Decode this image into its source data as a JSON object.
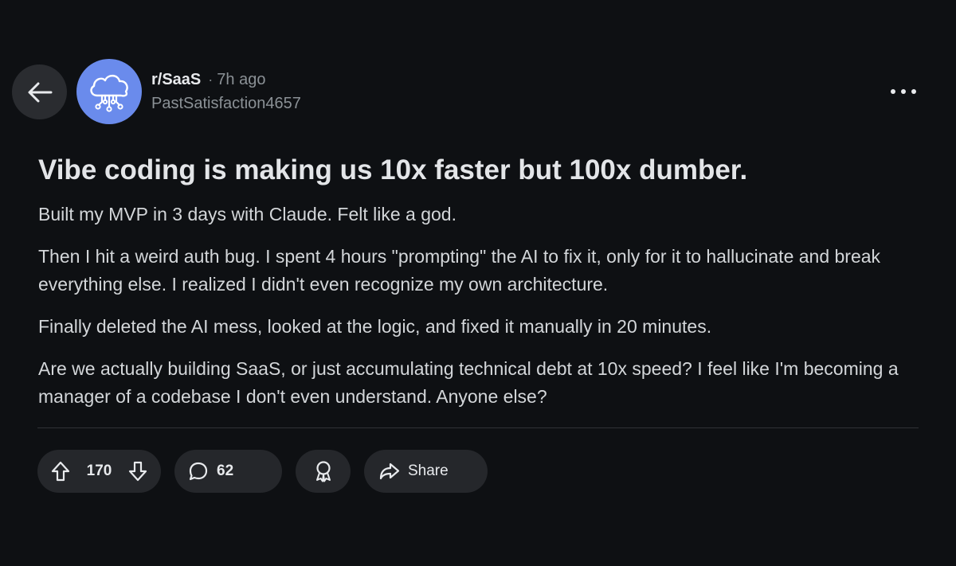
{
  "post": {
    "subreddit": "r/SaaS",
    "separator": "·",
    "time_ago": "7h ago",
    "author": "PastSatisfaction4657",
    "title": "Vibe coding is making us 10x faster but 100x dumber.",
    "paragraphs": [
      "Built my MVP in 3 days with Claude. Felt like a god.",
      "Then I hit a weird auth bug. I spent 4 hours \"prompting\" the AI to fix it, only for it to hallucinate and break everything else. I realized I didn't even recognize my own architecture.",
      "Finally deleted the AI mess, looked at the logic, and fixed it manually in 20 minutes.",
      "Are we actually building SaaS, or just accumulating technical debt at 10x speed? I feel like I'm becoming a manager of a codebase I don't even understand. Anyone else?"
    ]
  },
  "actions": {
    "upvote_count": "170",
    "comment_count": "62",
    "share_label": "Share"
  },
  "icons": {
    "back": "arrow-left-icon",
    "avatar": "cloud-circuit-icon",
    "more": "more-horizontal-icon",
    "upvote": "arrow-up-icon",
    "downvote": "arrow-down-icon",
    "comment": "speech-bubble-icon",
    "award": "award-icon",
    "share": "share-arrow-icon"
  },
  "colors": {
    "background": "#0e1013",
    "avatar_bg": "#6a8bec",
    "pill_bg": "#25272b",
    "text_primary": "#e3e5e8",
    "text_muted": "#8b9196"
  }
}
